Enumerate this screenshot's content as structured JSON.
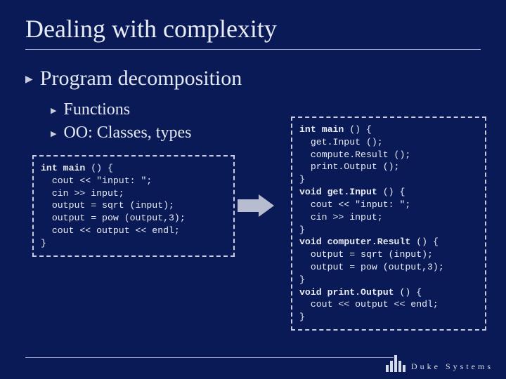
{
  "title": "Dealing with complexity",
  "bullets": {
    "l1": "Program decomposition",
    "l2a": "Functions",
    "l2b": "OO: Classes, types"
  },
  "code_left": {
    "l1a": "int ",
    "l1b": "main",
    "l1c": " () {",
    "l2": "  cout << \"input: \";",
    "l3": "  cin >> input;",
    "l4": "  output = sqrt (input);",
    "l5": "  output = pow (output,3);",
    "l6": "  cout << output << endl;",
    "l7": "}"
  },
  "code_right": {
    "l1a": "int ",
    "l1b": "main",
    "l1c": " () {",
    "l2": "  get.Input ();",
    "l3": "  compute.Result ();",
    "l4": "  print.Output ();",
    "l5": "}",
    "l6a": "void ",
    "l6b": "get.Input",
    "l6c": " () {",
    "l7": "  cout << \"input: \";",
    "l8": "  cin >> input;",
    "l9": "}",
    "l10a": "void ",
    "l10b": "computer.Result",
    "l10c": " () {",
    "l11": "  output = sqrt (input);",
    "l12": "  output = pow (output,3);",
    "l13": "}",
    "l14a": "void ",
    "l14b": "print.Output",
    "l14c": " () {",
    "l15": "  cout << output << endl;",
    "l16": "}"
  },
  "footer": {
    "brand1": "Duke",
    "brand2": "Systems"
  }
}
